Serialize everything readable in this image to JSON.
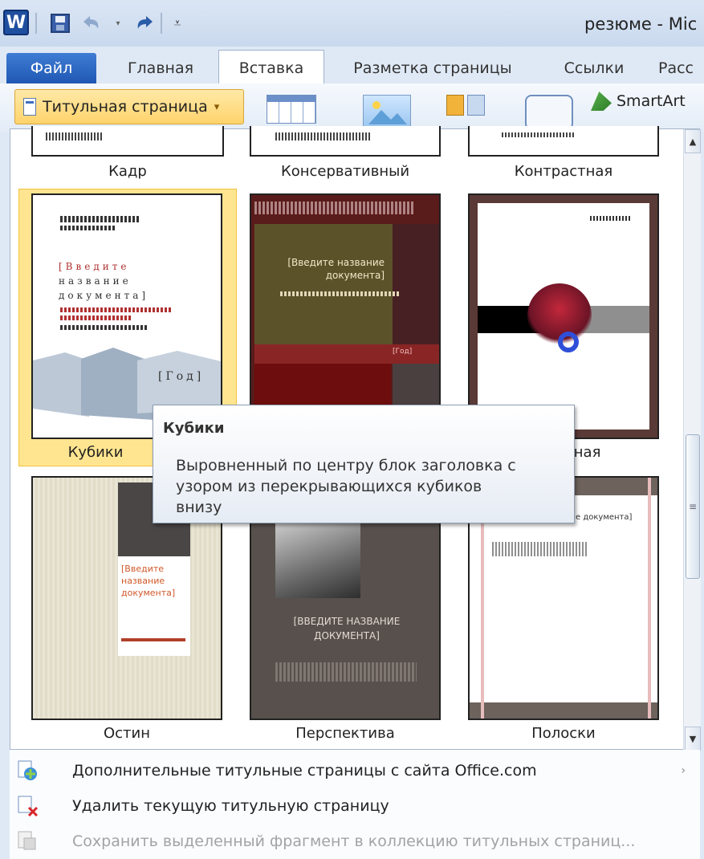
{
  "app": {
    "doc_title": "резюме - Mic",
    "icons": [
      "word-icon",
      "save-icon",
      "undo-icon",
      "redo-icon",
      "customize-icon"
    ]
  },
  "tabs": [
    {
      "label": "Файл"
    },
    {
      "label": "Главная"
    },
    {
      "label": "Вставка"
    },
    {
      "label": "Разметка страницы"
    },
    {
      "label": "Ссылки"
    },
    {
      "label": "Расс"
    }
  ],
  "ribbon": {
    "cover_page_label": "Титульная страница",
    "cover_dropdown_arrow": "▾",
    "smartart_label": "SmartArt"
  },
  "gallery": {
    "top_row": [
      "Кадр",
      "Консервативный",
      "Контрастная"
    ],
    "row1": {
      "cubes": {
        "label": "Кубики",
        "lines": [
          "[Введите",
          "название",
          "документа]"
        ],
        "year": "[Год]"
      },
      "middle": {
        "title": "[Введите название\nдокумента]",
        "year": "[Год]"
      },
      "right": {
        "label_tail": "нная"
      }
    },
    "row2": {
      "ostin": {
        "label": "Остин",
        "title": "[Введите\nназвание\nдокумента]"
      },
      "perspective": {
        "label": "Перспектива",
        "title": "[ВВЕДИТЕ НАЗВАНИЕ\nДОКУМЕНТА]"
      },
      "stripes": {
        "label": "Полоски",
        "title_tail": "е документа]"
      }
    }
  },
  "tooltip": {
    "title": "Кубики",
    "description": "Выровненный по центру блок заголовка с\nузором из перекрывающихся кубиков\nвнизу"
  },
  "scrollbar": {
    "up": "▲",
    "down": "▼",
    "grip": "≡"
  },
  "menu": [
    {
      "label": "Дополнительные титульные страницы с сайта Office.com",
      "enabled": true,
      "has_submenu": true,
      "arrow": "›"
    },
    {
      "label": "Удалить текущую титульную страницу",
      "enabled": true
    },
    {
      "label": "Сохранить выделенный фрагмент в коллекцию титульных страниц...",
      "enabled": false
    }
  ],
  "colors": {
    "accent_red": "#7a1518",
    "selection": "#ffe58f",
    "file_tab": "#2f6cc7"
  }
}
